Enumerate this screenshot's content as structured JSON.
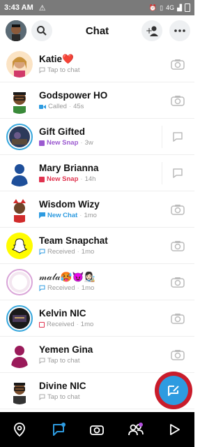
{
  "status_bar": {
    "time": "3:43 AM",
    "right_text": "4G"
  },
  "header": {
    "title": "Chat"
  },
  "colors": {
    "accent": "#2e9be0",
    "chat_blue": "#2e9be0",
    "snap_purple": "#9b59d0",
    "snap_red": "#e0334f",
    "fab_ring": "#c91c2b"
  },
  "chats": [
    {
      "name": "Katie❤️",
      "status": "Tap to chat",
      "time": "",
      "status_color": "",
      "status_icon": "chat-outline-icon",
      "action": "camera-icon"
    },
    {
      "name": "Godspower HO",
      "status": "Called",
      "time": "45s",
      "status_color": "",
      "status_icon": "video-icon",
      "action": "camera-icon"
    },
    {
      "name": "Gift Gifted",
      "status": "New Snap",
      "time": "3w",
      "status_color": "#9b59d0",
      "status_icon": "snap-filled-icon",
      "action": "chat-icon"
    },
    {
      "name": "Mary Brianna",
      "status": "New Snap",
      "time": "14h",
      "status_color": "#e0334f",
      "status_icon": "snap-filled-icon",
      "action": "chat-icon"
    },
    {
      "name": "Wisdom Wizy",
      "status": "New Chat",
      "time": "1mo",
      "status_color": "#2e9be0",
      "status_icon": "chat-filled-icon",
      "action": "camera-icon"
    },
    {
      "name": "Team Snapchat",
      "status": "Received",
      "time": "1mo",
      "status_color": "",
      "status_icon": "chat-outline-icon",
      "action": "camera-icon"
    },
    {
      "name": "𝓂𝒶𝓁𝒶🥵😈👩🏻‍🎨",
      "status": "Received",
      "time": "1mo",
      "status_color": "",
      "status_icon": "chat-outline-icon",
      "action": "camera-icon"
    },
    {
      "name": "Kelvin NIC",
      "status": "Received",
      "time": "1mo",
      "status_color": "",
      "status_icon": "snap-outline-icon",
      "action": "camera-icon"
    },
    {
      "name": "Yemen Gina",
      "status": "Tap to chat",
      "time": "",
      "status_color": "",
      "status_icon": "chat-outline-icon",
      "action": "camera-icon"
    },
    {
      "name": "Divine NIC",
      "status": "Tap to chat",
      "time": "",
      "status_color": "",
      "status_icon": "chat-outline-icon",
      "action": "camera-icon"
    }
  ],
  "nav": [
    "map-icon",
    "chat-icon",
    "camera-icon",
    "friends-icon",
    "play-icon"
  ]
}
